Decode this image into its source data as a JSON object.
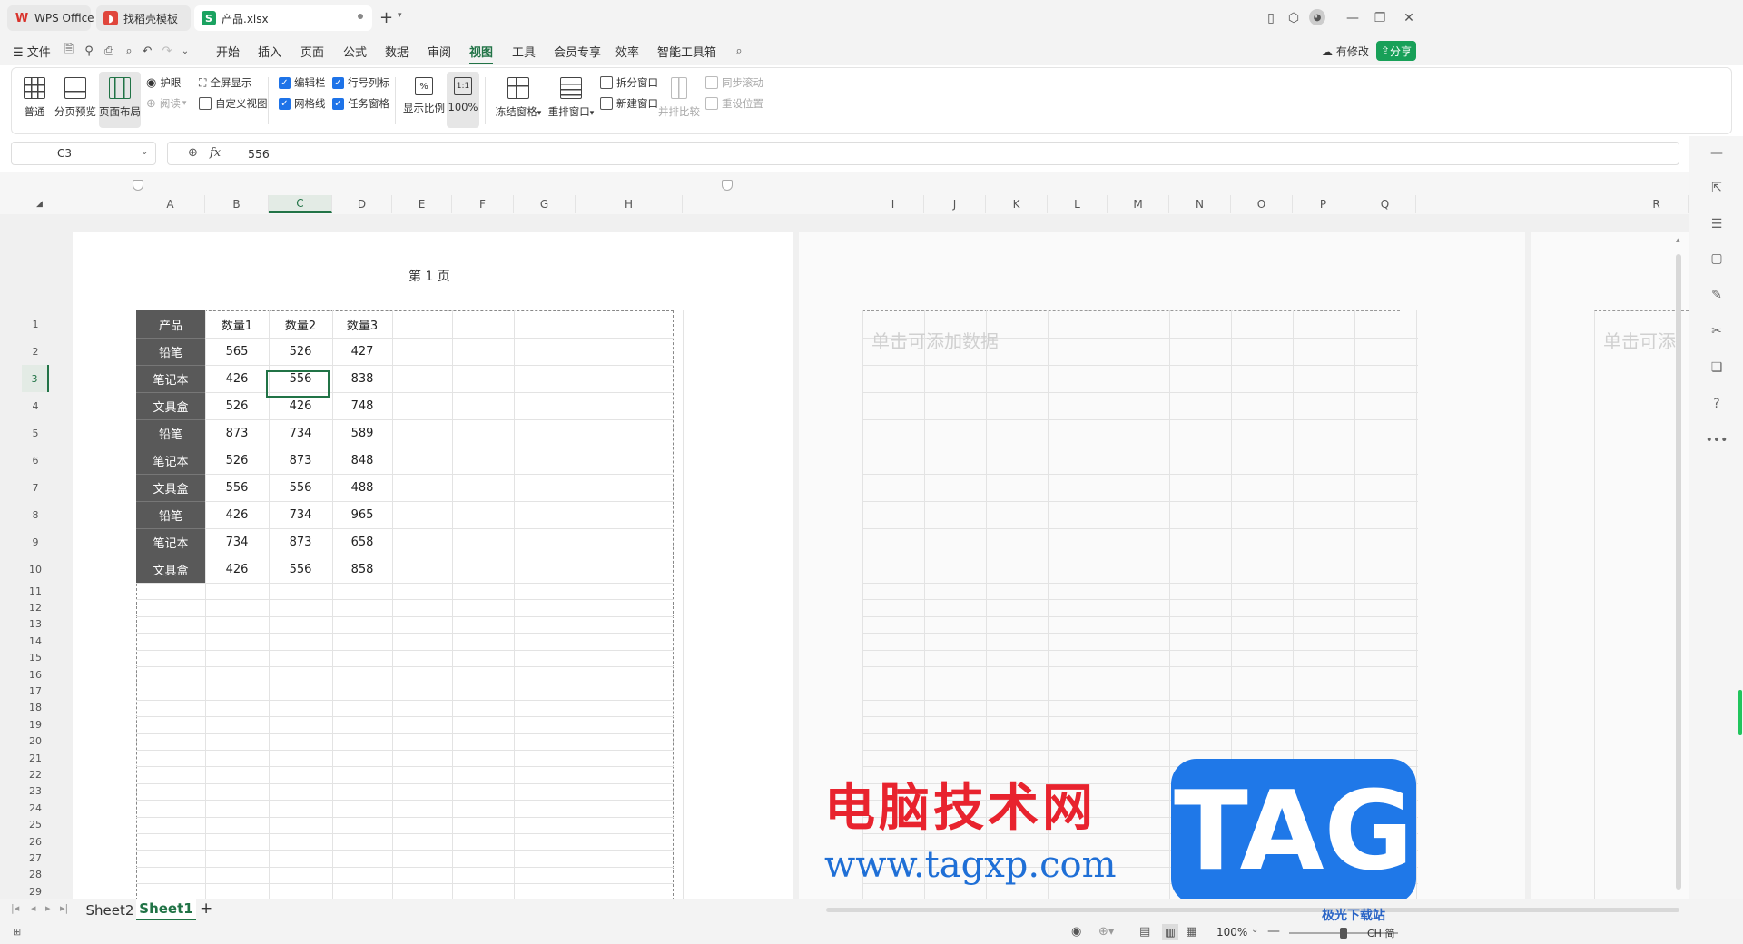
{
  "titlebar": {
    "tabs": [
      {
        "label": "WPS Office",
        "icon": "wps-logo-icon",
        "color": "#d9322b"
      },
      {
        "label": "找稻壳模板",
        "icon": "docer-icon",
        "color": "#e0463c"
      },
      {
        "label": "产品.xlsx",
        "icon": "spreadsheet-s-icon",
        "color": "#1aa260"
      }
    ],
    "new_tab_label": "+"
  },
  "menubar": {
    "file_label": "文件",
    "items": [
      "开始",
      "插入",
      "页面",
      "公式",
      "数据",
      "审阅",
      "视图",
      "工具",
      "会员专享",
      "效率",
      "智能工具箱"
    ],
    "active_item": "视图",
    "modified_label": "有修改",
    "share_label": "分享"
  },
  "ribbon": {
    "normal": "普通",
    "page_break_preview": "分页预览",
    "page_layout": "页面布局",
    "eye_protect": "护眼",
    "reading": "阅读",
    "fullscreen": "全屏显示",
    "custom_view": "自定义视图",
    "edit_bar": "编辑栏",
    "gridlines": "网格线",
    "row_col_headers": "行号列标",
    "task_pane": "任务窗格",
    "zoom": "显示比例",
    "zoom_100": "100%",
    "zoom_icon_text": "1:1",
    "freeze_panes": "冻结窗格",
    "arrange_window": "重排窗口",
    "split_window": "拆分窗口",
    "new_window": "新建窗口",
    "side_by_side": "并排比较",
    "sync_scroll": "同步滚动",
    "reset_position": "重设位置"
  },
  "formula_bar": {
    "cell_ref": "C3",
    "fx_label": "fx",
    "value": "556"
  },
  "columns_page1": [
    "A",
    "B",
    "C",
    "D",
    "E",
    "F",
    "G",
    "H"
  ],
  "columns_page2": [
    "I",
    "J",
    "K",
    "L",
    "M",
    "N",
    "O",
    "P",
    "Q"
  ],
  "columns_page3": [
    "R"
  ],
  "selected_column": "C",
  "selected_row": 3,
  "page_label": "第 1 页",
  "add_data_hint": "单击可添加数据",
  "add_data_hint_partial": "单击可添",
  "table": {
    "headers": [
      "产品",
      "数量1",
      "数量2",
      "数量3"
    ],
    "rows": [
      [
        "铅笔",
        "565",
        "526",
        "427"
      ],
      [
        "笔记本",
        "426",
        "556",
        "838"
      ],
      [
        "文具盒",
        "526",
        "426",
        "748"
      ],
      [
        "铅笔",
        "873",
        "734",
        "589"
      ],
      [
        "笔记本",
        "526",
        "873",
        "848"
      ],
      [
        "文具盒",
        "556",
        "556",
        "488"
      ],
      [
        "铅笔",
        "426",
        "734",
        "965"
      ],
      [
        "笔记本",
        "734",
        "873",
        "658"
      ],
      [
        "文具盒",
        "426",
        "556",
        "858"
      ]
    ]
  },
  "row_numbers": [
    "1",
    "2",
    "3",
    "4",
    "5",
    "6",
    "7",
    "8",
    "9",
    "10",
    "11",
    "12",
    "13",
    "14",
    "15",
    "16",
    "17",
    "18",
    "19",
    "20",
    "21",
    "22",
    "23",
    "24",
    "25",
    "26",
    "27",
    "28",
    "29"
  ],
  "sheets": [
    "Sheet2",
    "Sheet1"
  ],
  "active_sheet": "Sheet1",
  "add_sheet_label": "+",
  "statusbar": {
    "zoom": "100%",
    "ime": "CH 简"
  },
  "watermark": {
    "text_cn": "电脑技术网",
    "url": "www.tagxp.com",
    "tag": "TAG",
    "site2": "极光下载站"
  },
  "colors": {
    "accent_green": "#217346",
    "share_green": "#18a058",
    "checkbox_blue": "#1e73e8",
    "header_fill": "#595959"
  }
}
